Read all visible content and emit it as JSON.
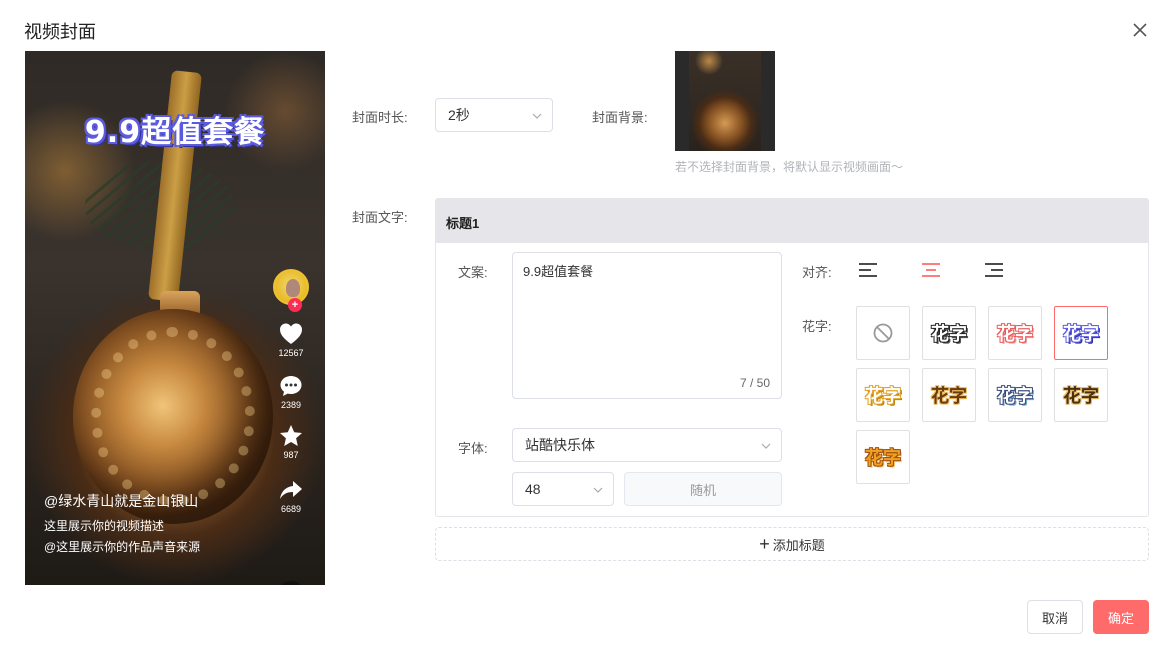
{
  "dialog": {
    "title": "视频封面"
  },
  "preview": {
    "cover_text": "9.9超值套餐",
    "author": "@绿水青山就是金山银山",
    "description": "这里展示你的视频描述",
    "music": "@这里展示你的作品声音来源",
    "follow": "+",
    "actions": [
      {
        "icon": "heart-icon",
        "count": "12567"
      },
      {
        "icon": "comment-icon",
        "count": "2389"
      },
      {
        "icon": "star-icon",
        "count": "987"
      },
      {
        "icon": "share-icon",
        "count": "6689"
      }
    ]
  },
  "form": {
    "duration_label": "封面时长:",
    "duration_value": "2秒",
    "background_label": "封面背景:",
    "background_hint": "若不选择封面背景，将默认显示视频画面～",
    "text_label": "封面文字:",
    "panel": {
      "header": "标题1",
      "copy_label": "文案:",
      "copy_value": "9.9超值套餐",
      "copy_count": "7 / 50",
      "font_label": "字体:",
      "font_value": "站酷快乐体",
      "size_value": "48",
      "random_label": "随机",
      "align_label": "对齐:",
      "align_options": [
        "left",
        "center",
        "right"
      ],
      "align_selected": "center",
      "fx_label": "花字:",
      "fx_text": "花字",
      "fx_selected_index": 3
    },
    "add_title_label": "添加标题"
  },
  "footer": {
    "cancel_label": "取消",
    "ok_label": "确定"
  },
  "colors": {
    "accent": "#ff6b6b",
    "cover_outline": "#5b5be0"
  }
}
